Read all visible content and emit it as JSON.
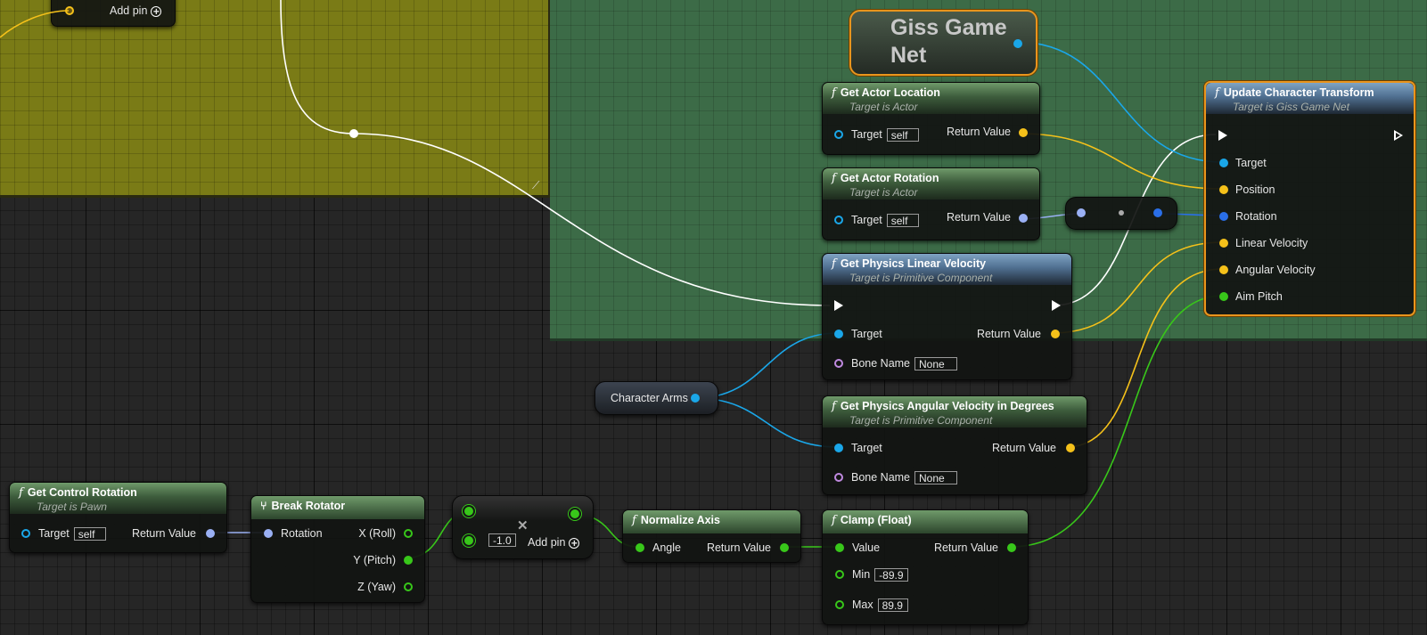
{
  "comment_olive": {
    "add_pin": "Add pin"
  },
  "giss": {
    "title": "Giss Game Net"
  },
  "get_actor_location": {
    "title": "Get Actor Location",
    "subtitle": "Target is Actor",
    "target": "Target",
    "target_value": "self",
    "return": "Return Value"
  },
  "get_actor_rotation": {
    "title": "Get Actor Rotation",
    "subtitle": "Target is Actor",
    "target": "Target",
    "target_value": "self",
    "return": "Return Value"
  },
  "get_linear_velocity": {
    "title": "Get Physics Linear Velocity",
    "subtitle": "Target is Primitive Component",
    "target": "Target",
    "bone": "Bone Name",
    "bone_value": "None",
    "return": "Return Value"
  },
  "get_angular_velocity": {
    "title": "Get Physics Angular Velocity in Degrees",
    "subtitle": "Target is Primitive Component",
    "target": "Target",
    "bone": "Bone Name",
    "bone_value": "None",
    "return": "Return Value"
  },
  "update_transform": {
    "title": "Update Character Transform",
    "subtitle": "Target is Giss Game Net",
    "pins": [
      "Target",
      "Position",
      "Rotation",
      "Linear Velocity",
      "Angular Velocity",
      "Aim Pitch"
    ]
  },
  "character_arms": {
    "label": "Character Arms"
  },
  "get_control_rotation": {
    "title": "Get Control Rotation",
    "subtitle": "Target is Pawn",
    "target": "Target",
    "target_value": "self",
    "return": "Return Value"
  },
  "break_rotator": {
    "title": "Break Rotator",
    "input": "Rotation",
    "outputs": [
      "X (Roll)",
      "Y (Pitch)",
      "Z (Yaw)"
    ]
  },
  "multiply": {
    "value": "-1.0",
    "add_pin": "Add pin",
    "symbol": "✕"
  },
  "normalize_axis": {
    "title": "Normalize Axis",
    "input": "Angle",
    "return": "Return Value"
  },
  "clamp": {
    "title": "Clamp (Float)",
    "value": "Value",
    "min": "Min",
    "min_value": "-89.9",
    "max": "Max",
    "max_value": "89.9",
    "return": "Return Value"
  },
  "colors": {
    "object": "#1aa7e9",
    "vector": "#f5c11a",
    "rotator": "#9ab0f4",
    "float": "#38c71a",
    "name": "#c08ae0",
    "exec": "#ffffff",
    "selection": "#e9951d",
    "comment_olive": "#7a7b16",
    "comment_green": "#3c6b47"
  }
}
